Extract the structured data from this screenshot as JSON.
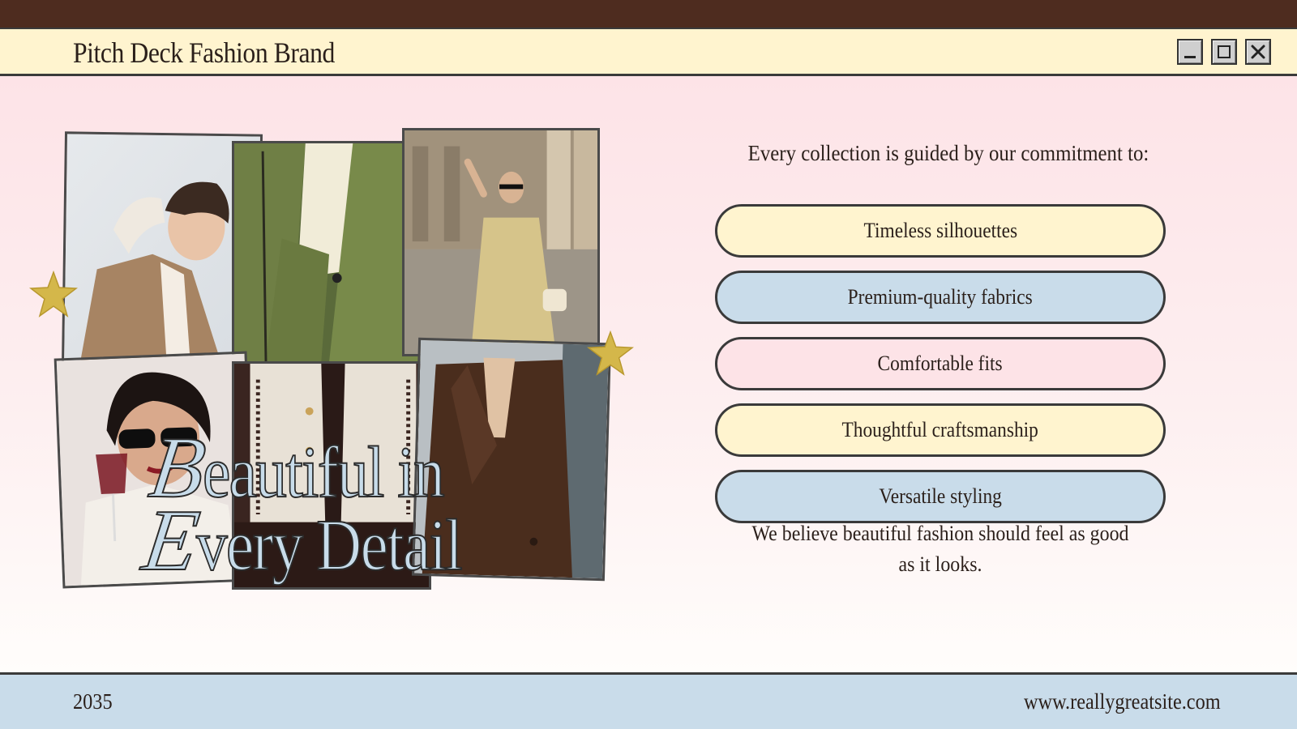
{
  "window": {
    "title": "Pitch Deck Fashion Brand",
    "controls": {
      "minimize": "minimize-icon",
      "maximize": "maximize-icon",
      "close": "close-icon"
    }
  },
  "colors": {
    "top_strip": "#4e2c1f",
    "title_bar": "#fff4cf",
    "footer": "#c9dcea",
    "pill_yellow": "#fff4cf",
    "pill_blue": "#c9dcea",
    "pill_pink": "#fde3e7",
    "border": "#3a3a3a"
  },
  "collage": {
    "headline_line1_initial": "B",
    "headline_line1_rest": "eautiful in",
    "headline_line2_initial": "E",
    "headline_line2_rest": "very Detail",
    "decorations": [
      "gold-star-icon",
      "gold-star-icon"
    ]
  },
  "main": {
    "intro": "Every collection is guided by our commitment to:",
    "commitments": [
      {
        "label": "Timeless silhouettes",
        "color": "yellow"
      },
      {
        "label": "Premium-quality fabrics",
        "color": "blue"
      },
      {
        "label": "Comfortable fits",
        "color": "pink"
      },
      {
        "label": "Thoughtful craftsmanship",
        "color": "yellow"
      },
      {
        "label": "Versatile styling",
        "color": "blue"
      }
    ],
    "closing": "We believe beautiful fashion should feel as good as it looks."
  },
  "footer": {
    "year": "2035",
    "url": "www.reallygreatsite.com"
  }
}
